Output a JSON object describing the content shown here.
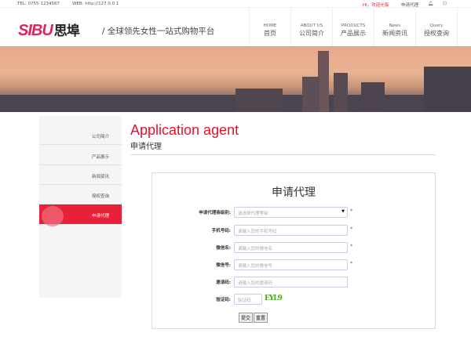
{
  "topbar": {
    "tel": "TEL: 0755-1234567",
    "web": "WEB: http://127.0.0.1",
    "welcome": "HI，欢迎光临",
    "apply": "申请代理"
  },
  "header": {
    "logo_en": "SIBU",
    "logo_cn": "思埠",
    "slogan": "/ 全球领先女性一站式购物平台",
    "nav": [
      {
        "en": "HOME",
        "cn": "首页"
      },
      {
        "en": "ABOUT US",
        "cn": "公司简介"
      },
      {
        "en": "PRODUCTS",
        "cn": "产品展示"
      },
      {
        "en": "News",
        "cn": "新闻资讯"
      },
      {
        "en": "Query",
        "cn": "授权查询"
      }
    ]
  },
  "sidebar": [
    "公司简介",
    "产品展示",
    "新闻资讯",
    "授权查询",
    "申请代理"
  ],
  "page": {
    "title_en": "Application agent",
    "title_cn": "申请代理"
  },
  "form": {
    "title": "申请代理",
    "fields": [
      {
        "label": "申请代理商级别:",
        "placeholder": "请选择代理等级"
      },
      {
        "label": "手机号码:",
        "placeholder": "请输入您的手机号码"
      },
      {
        "label": "微信名:",
        "placeholder": "请输入您的微信名"
      },
      {
        "label": "微信号:",
        "placeholder": "请输入您的微信号"
      },
      {
        "label": "邀请码:",
        "placeholder": "请输入您的邀请码"
      },
      {
        "label": "验证码:",
        "placeholder": "验证码"
      }
    ],
    "captcha": "EYL9",
    "required_mark": "*",
    "submit": "提交",
    "reset": "重置"
  }
}
